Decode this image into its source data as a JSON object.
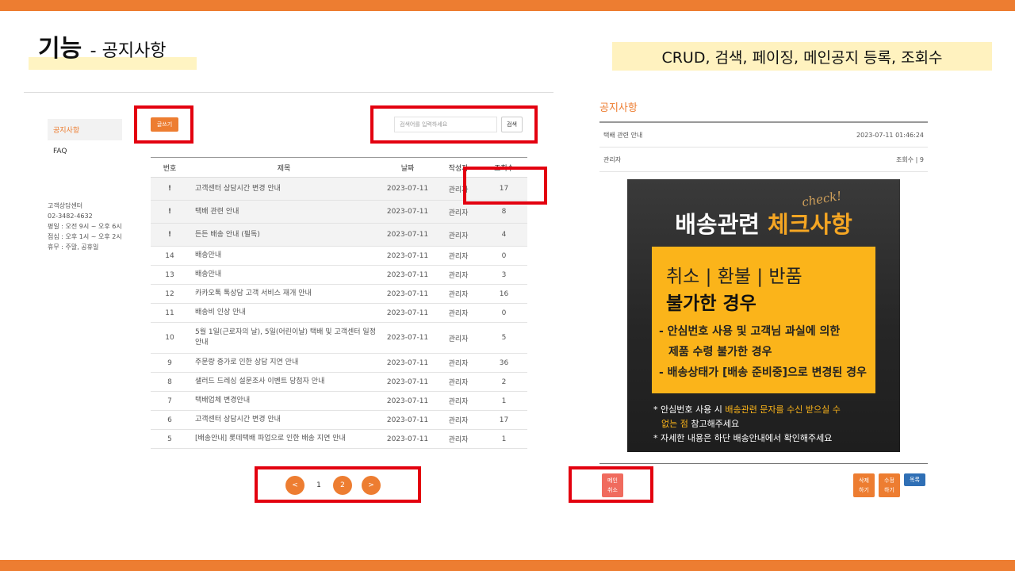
{
  "slide": {
    "title": "기능",
    "subtitle": "- 공지사항",
    "features": "CRUD, 검색, 페이징, 메인공지 등록, 조회수"
  },
  "list_page": {
    "sidebar": {
      "items": [
        {
          "label": "공지사항",
          "active": true
        },
        {
          "label": "FAQ",
          "active": false
        }
      ],
      "contact": [
        "고객상담센터",
        "02-3482-4632",
        "평일 : 오전 9시 ~ 오후 6시",
        "점심 : 오후 1시 ~ 오후 2시",
        "휴무 : 주말, 공휴일"
      ]
    },
    "write_button": "글쓰기",
    "search": {
      "placeholder": "검색어를 입력하세요",
      "button": "검색"
    },
    "table": {
      "headers": [
        "번호",
        "제목",
        "날짜",
        "작성자",
        "조회수"
      ],
      "rows": [
        {
          "no": "!",
          "title": "고객센터 상담시간 변경 안내",
          "date": "2023-07-11",
          "author": "관리자",
          "views": "17",
          "pinned": true
        },
        {
          "no": "!",
          "title": "택배 관련 안내",
          "date": "2023-07-11",
          "author": "관리자",
          "views": "8",
          "pinned": true
        },
        {
          "no": "!",
          "title": "든든 배송 안내 (필독)",
          "date": "2023-07-11",
          "author": "관리자",
          "views": "4",
          "pinned": true
        },
        {
          "no": "14",
          "title": "배송안내",
          "date": "2023-07-11",
          "author": "관리자",
          "views": "0"
        },
        {
          "no": "13",
          "title": "배송안내",
          "date": "2023-07-11",
          "author": "관리자",
          "views": "3"
        },
        {
          "no": "12",
          "title": "카카오톡 톡상담 고객 서비스 재개 안내",
          "date": "2023-07-11",
          "author": "관리자",
          "views": "16"
        },
        {
          "no": "11",
          "title": "배송비 인상 안내",
          "date": "2023-07-11",
          "author": "관리자",
          "views": "0"
        },
        {
          "no": "10",
          "title": "5월 1일(근로자의 날), 5일(어린이날) 택배 및 고객센터 일정 안내",
          "date": "2023-07-11",
          "author": "관리자",
          "views": "5",
          "tall": true
        },
        {
          "no": "9",
          "title": "주문량 증가로 인한 상담 지연 안내",
          "date": "2023-07-11",
          "author": "관리자",
          "views": "36"
        },
        {
          "no": "8",
          "title": "샐러드 드레싱 설문조사 이벤트 당첨자 안내",
          "date": "2023-07-11",
          "author": "관리자",
          "views": "2"
        },
        {
          "no": "7",
          "title": "택배업체 변경안내",
          "date": "2023-07-11",
          "author": "관리자",
          "views": "1"
        },
        {
          "no": "6",
          "title": "고객센터 상담시간 변경 안내",
          "date": "2023-07-11",
          "author": "관리자",
          "views": "17"
        },
        {
          "no": "5",
          "title": "[배송안내] 롯데택배 파업으로 인한 배송 지연 안내",
          "date": "2023-07-11",
          "author": "관리자",
          "views": "1"
        }
      ]
    },
    "pagination": {
      "prev": "<",
      "pages": [
        "1",
        "2"
      ],
      "current": "2",
      "next": ">"
    }
  },
  "detail_page": {
    "title": "공지사항",
    "post_title": "택배 관련 안내",
    "datetime": "2023-07-11 01:46:24",
    "author": "관리자",
    "views": "조회수 | 9",
    "poster": {
      "script": "check!",
      "headline_a": "배송관련 ",
      "headline_b": "체크사항",
      "line1": "취소 | 환불 | 반품",
      "line2": "불가한 경우",
      "bullet1": "- 안심번호 사용 및 고객님 과실에 의한",
      "bullet2": "제품 수령 불가한 경우",
      "bullet3": "- 배송상태가 [배송 준비중]으로 변경된 경우",
      "note1_a": "* 안심번호 사용 시 ",
      "note1_b": "배송관련 문자를 수신 받으실 수",
      "note2_a": "없는 점",
      "note2_b": " 참고해주세요",
      "note3": "* 자세한 내용은 하단 배송안내에서 확인해주세요"
    },
    "buttons": {
      "main_cancel": [
        "메인",
        "취소"
      ],
      "delete": [
        "삭제",
        "하기"
      ],
      "edit": [
        "수정",
        "하기"
      ],
      "list": "목록"
    }
  },
  "colors": {
    "accent": "#ed7d31",
    "highlight_box": "#e3000f",
    "list_button": "#2f6fb5",
    "poster_card": "#fbb41a"
  }
}
